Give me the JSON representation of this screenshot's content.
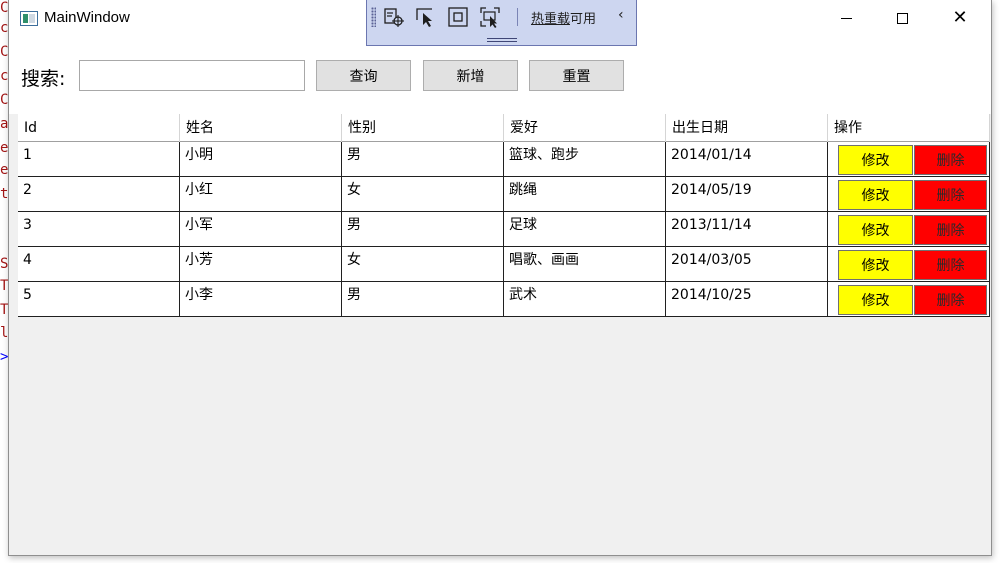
{
  "background_editor": {
    "chars": [
      "C",
      "c",
      "C",
      "c",
      "C",
      "a",
      "e",
      "e",
      "t",
      "S",
      "T",
      "T",
      "l",
      ">"
    ]
  },
  "window": {
    "title": "MainWindow",
    "app_icon": "window-app-icon",
    "controls": {
      "minimize": "minimize-icon",
      "maximize": "maximize-icon",
      "close": "✕"
    }
  },
  "hot_reload_toolbar": {
    "icons": [
      "select-element-icon",
      "pointer-select-icon",
      "layout-adorner-icon",
      "track-focus-icon"
    ],
    "label_underlined": "热重载",
    "label_rest": "可用",
    "collapse": "‹"
  },
  "search": {
    "label": "搜索:",
    "value": "",
    "placeholder": "",
    "buttons": {
      "query": "查询",
      "add": "新增",
      "reset": "重置"
    }
  },
  "grid": {
    "columns": [
      "Id",
      "姓名",
      "性别",
      "爱好",
      "出生日期",
      "操作"
    ],
    "rows": [
      {
        "id": "1",
        "name": "小明",
        "gender": "男",
        "hobby": "篮球、跑步",
        "birth": "2014/01/14"
      },
      {
        "id": "2",
        "name": "小红",
        "gender": "女",
        "hobby": "跳绳",
        "birth": "2014/05/19"
      },
      {
        "id": "3",
        "name": "小军",
        "gender": "男",
        "hobby": "足球",
        "birth": "2013/11/14"
      },
      {
        "id": "4",
        "name": "小芳",
        "gender": "女",
        "hobby": "唱歌、画画",
        "birth": "2014/03/05"
      },
      {
        "id": "5",
        "name": "小李",
        "gender": "男",
        "hobby": "武术",
        "birth": "2014/10/25"
      }
    ],
    "row_actions": {
      "edit": "修改",
      "delete": "删除"
    },
    "colors": {
      "edit_button": "#ffff00",
      "delete_button": "#ff0000"
    }
  }
}
